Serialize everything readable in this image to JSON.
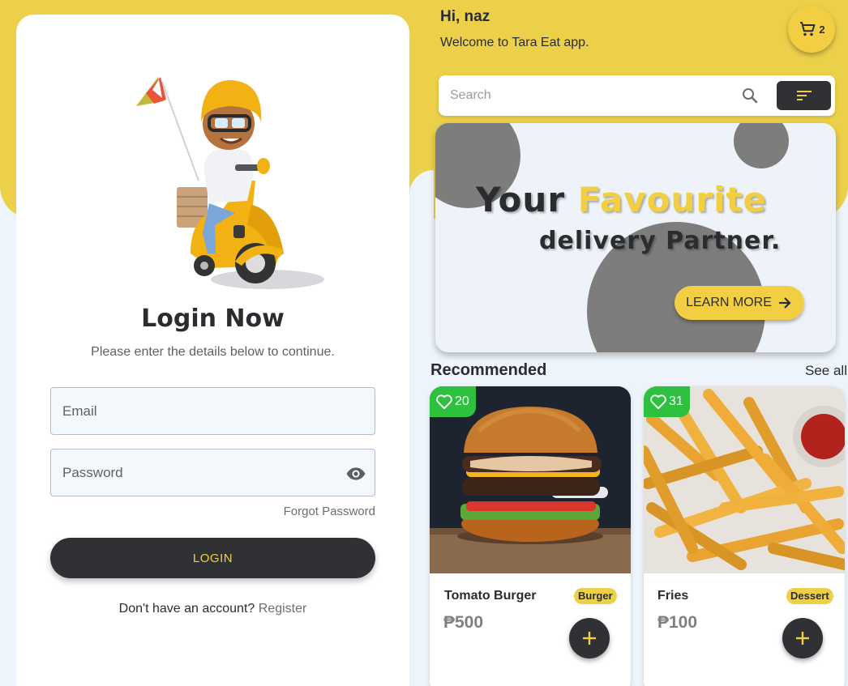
{
  "login": {
    "title": "Login Now",
    "subtitle": "Please enter the details below to continue.",
    "email_placeholder": "Email",
    "password_placeholder": "Password",
    "forgot_password": "Forgot Password",
    "login_button": "LOGIN",
    "no_account_text": "Don't have an account?",
    "register_link": "Register"
  },
  "home": {
    "greeting": "Hi, naz",
    "welcome": "Welcome to Tara Eat app.",
    "cart_count": "2",
    "search_placeholder": "Search",
    "banner": {
      "line1_part1": "Your",
      "line1_highlight": "Favourite",
      "line2": "delivery Partner.",
      "button": "LEARN MORE"
    },
    "section_title": "Recommended",
    "see_all": "See all",
    "items": [
      {
        "likes": "20",
        "name": "Tomato Burger",
        "category": "Burger",
        "price": "₱500"
      },
      {
        "likes": "31",
        "name": "Fries",
        "category": "Dessert",
        "price": "₱100"
      }
    ]
  },
  "colors": {
    "accent_yellow": "#ecd04a",
    "dark": "#303134",
    "like_green": "#2ec13f",
    "background": "#eef4fb"
  },
  "icons": [
    "cart-icon",
    "search-icon",
    "filter-icon",
    "eye-icon",
    "arrow-right-icon",
    "heart-icon",
    "plus-icon"
  ]
}
